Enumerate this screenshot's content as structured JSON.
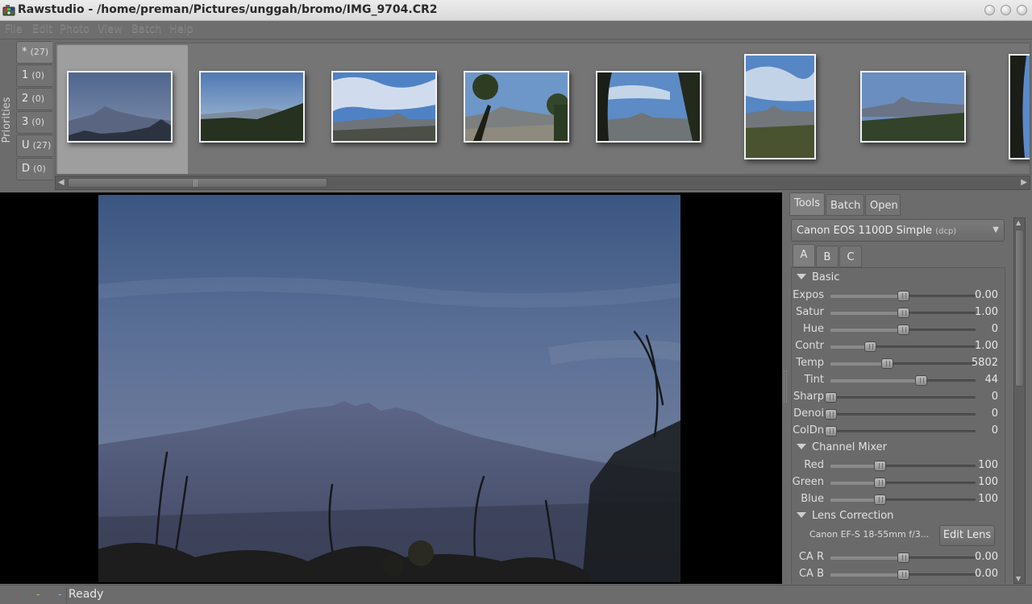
{
  "window": {
    "title": "Rawstudio - /home/preman/Pictures/unggah/bromo/IMG_9704.CR2"
  },
  "menu": [
    "File",
    "Edit",
    "Photo",
    "View",
    "Batch",
    "Help"
  ],
  "priorities": {
    "label": "Priorities",
    "tabs": [
      {
        "label": "*",
        "count": "(27)"
      },
      {
        "label": "1",
        "count": "(0)"
      },
      {
        "label": "2",
        "count": "(0)"
      },
      {
        "label": "3",
        "count": "(0)"
      },
      {
        "label": "U",
        "count": "(27)"
      },
      {
        "label": "D",
        "count": "(0)"
      }
    ]
  },
  "panel": {
    "tabs": [
      "Tools",
      "Batch",
      "Open"
    ],
    "profile": {
      "name": "Canon EOS 1100D Simple",
      "suffix": "(dcp)"
    },
    "subtabs": [
      "A",
      "B",
      "C"
    ],
    "sections": {
      "basic": "Basic",
      "channel_mixer": "Channel Mixer",
      "lens_correction": "Lens Correction"
    },
    "basic": [
      {
        "label": "Expos",
        "value": "0.00",
        "level": 0.5
      },
      {
        "label": "Satur",
        "value": "1.00",
        "level": 0.5
      },
      {
        "label": "Hue",
        "value": "0",
        "level": 0.5
      },
      {
        "label": "Contr",
        "value": "1.00",
        "level": 0.27
      },
      {
        "label": "Temp",
        "value": "5802",
        "level": 0.39
      },
      {
        "label": "Tint",
        "value": "44",
        "level": 0.62
      },
      {
        "label": "Sharp",
        "value": "0",
        "level": 0.0
      },
      {
        "label": "Denoi",
        "value": "0",
        "level": 0.0
      },
      {
        "label": "ColDn",
        "value": "0",
        "level": 0.0
      }
    ],
    "channel_mixer": [
      {
        "label": "Red",
        "value": "100",
        "level": 0.34
      },
      {
        "label": "Green",
        "value": "100",
        "level": 0.34
      },
      {
        "label": "Blue",
        "value": "100",
        "level": 0.34
      }
    ],
    "lens": {
      "name": "Canon EF-S 18-55mm f/3...",
      "edit_label": "Edit Lens",
      "sliders": [
        {
          "label": "CA R",
          "value": "0.00",
          "level": 0.5
        },
        {
          "label": "CA B",
          "value": "0.00",
          "level": 0.5
        }
      ]
    }
  },
  "status": {
    "text": "Ready"
  }
}
